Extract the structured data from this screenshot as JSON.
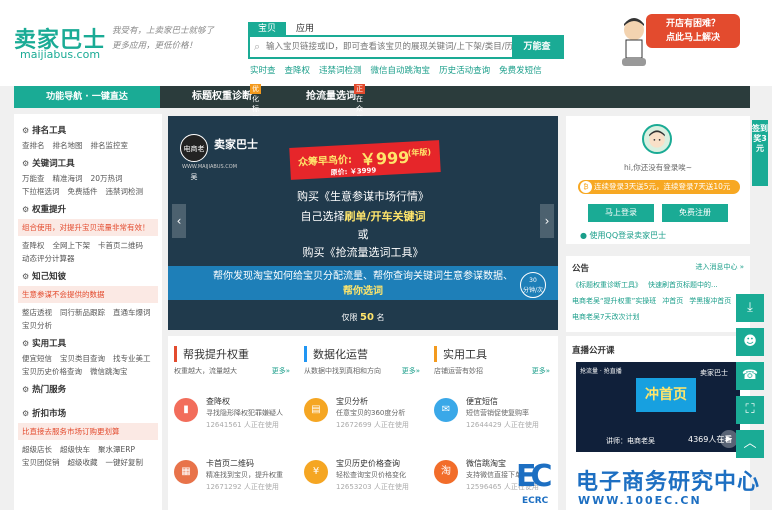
{
  "header": {
    "logo_text": "卖家巴士",
    "logo_url": "maijiabus.com",
    "slogan_line1": "我受有，上卖家巴士就够了",
    "slogan_line2": "更多应用，更低价格！",
    "search_tabs": [
      "宝贝",
      "应用"
    ],
    "search_placeholder": "输入宝贝链接或ID，即可查看该宝贝的展现关键词/上下架/类目/历史价格等...",
    "search_button": "万能查",
    "quick_links": [
      "实时查",
      "查降权",
      "违禁词检测",
      "微信自动跳淘宝",
      "历史活动查询",
      "免费发短信"
    ],
    "help_line1": "开店有困难？",
    "help_line2": "点此马上解决"
  },
  "nav": {
    "all_label": "功能导航 · 一键直达",
    "items": [
      {
        "label": "标题权重诊断",
        "tag": "优化标题"
      },
      {
        "label": "抢流量选词",
        "tag": "正在众筹"
      }
    ]
  },
  "sidebar": {
    "sections": [
      {
        "title": "排名工具",
        "links": [
          "查排名",
          "排名地图",
          "排名监控室"
        ]
      },
      {
        "title": "关键词工具",
        "links": [
          "万能查",
          "精准海词",
          "20万热词",
          "下拉框选词",
          "免费插件",
          "违禁词检测"
        ]
      },
      {
        "title": "权重提升",
        "promo": "组合使用，对提升宝贝流量非常有效！",
        "links": [
          "查降权",
          "全网上下架",
          "卡首页二维码",
          "动态评分计算器"
        ]
      },
      {
        "title": "知己知彼",
        "promo": "生意参谋不会提供的数据",
        "links": [
          "整店透视",
          "同行新品跟踪",
          "直通车爆词",
          "宝贝分析"
        ]
      },
      {
        "title": "实用工具",
        "links": [
          "便宜短信",
          "宝贝类目查询",
          "找专业美工",
          "宝贝历史价格查询",
          "微信跳淘宝"
        ]
      },
      {
        "title": "热门服务",
        "links": []
      },
      {
        "title": "折扣市场",
        "promo": "比直接去服务市场订购更划算",
        "links": [
          "超级店长",
          "超级快车",
          "聚水潭ERP",
          "宝贝团促销",
          "超级收藏",
          "一键好复制"
        ]
      }
    ]
  },
  "banner": {
    "brand": "卖家巴士",
    "logo_text": "电商老吴",
    "brand_sub": "WWW.MAIJIABUS.COM",
    "early_bird": "众筹早鸟价:",
    "price": "￥999",
    "price_unit": "(年版)",
    "orig_price": "原价: ￥3999",
    "line1": "购买《生意参谋市场行情》",
    "line2_pre": "自己选择",
    "line2_hl": "刷单/开车关键词",
    "line3": "或",
    "line4": "购买《抢流量选词工具》",
    "bar_line1": "帮你发现淘宝如何给宝贝分配流量、帮你查询关键词生意参谋数据、",
    "bar_line2": "帮你选词",
    "stamp_line1": "30",
    "stamp_line2": "分钟/次",
    "limit_pre": "仅限",
    "limit_num": "50",
    "limit_post": "名"
  },
  "columns": [
    {
      "title": "帮我提升权重",
      "sub": "权重越大，流量越大",
      "more": "更多»",
      "tools": [
        {
          "name": "查降权",
          "desc": "寻找隐形降权犯罪嫌疑人",
          "use": "12641561 人正在使用",
          "icon": "chart-icon",
          "color": "#f26d5b"
        },
        {
          "name": "卡首页二维码",
          "desc": "精准找到宝贝，提升权重",
          "use": "12671292 人正在使用",
          "icon": "qrcode-icon",
          "color": "#e8734a"
        }
      ]
    },
    {
      "title": "数据化运营",
      "sub": "从数据中找到真相和方向",
      "more": "更多»",
      "tools": [
        {
          "name": "宝贝分析",
          "desc": "任意宝贝的360度分析",
          "use": "12672699 人正在使用",
          "icon": "analysis-icon",
          "color": "#f5a623"
        },
        {
          "name": "宝贝历史价格查询",
          "desc": "轻松查询宝贝价格变化",
          "use": "12653203 人正在使用",
          "icon": "price-icon",
          "color": "#f5a623"
        }
      ]
    },
    {
      "title": "实用工具",
      "sub": "店铺运营有妙招",
      "more": "更多»",
      "tools": [
        {
          "name": "便宜短信",
          "desc": "短信营销促使复购率",
          "use": "12644429 人正在使用",
          "icon": "sms-icon",
          "color": "#3aa8e8"
        },
        {
          "name": "微信跳淘宝",
          "desc": "支持微信直接下单",
          "use": "12596465 人正在使用",
          "icon": "taobao-icon",
          "color": "#f26d2a"
        }
      ]
    }
  ],
  "user_panel": {
    "greeting": "hi,你还没有登录唉~",
    "bonus": "连续登录3天送5元，连续登录7天送10元",
    "login_btn": "马上登录",
    "register_btn": "免费注册",
    "qq_login": "使用QQ登录卖家巴士"
  },
  "notice": {
    "title": "公告",
    "more": "进入消息中心 »",
    "items": [
      "《标题权重诊断工具》",
      "快速刷首页标题中的...",
      "电商老吴“提升权重”实操班",
      "冲首页",
      "学黑搜冲首页",
      "电商老吴7天改次计划"
    ]
  },
  "live": {
    "title": "直播公开课",
    "brand": "卖家巴士",
    "headline": "冲首页",
    "teacher": "讲师：电商老吴",
    "count": "4369人在看",
    "top_note": "抢流量 · 抢直播"
  },
  "right_stick": "签到奖3元",
  "watermark": {
    "logo": "EC",
    "sub": "ECRC",
    "title": "电子商务研究中心",
    "url": "WWW.100EC.CN"
  }
}
